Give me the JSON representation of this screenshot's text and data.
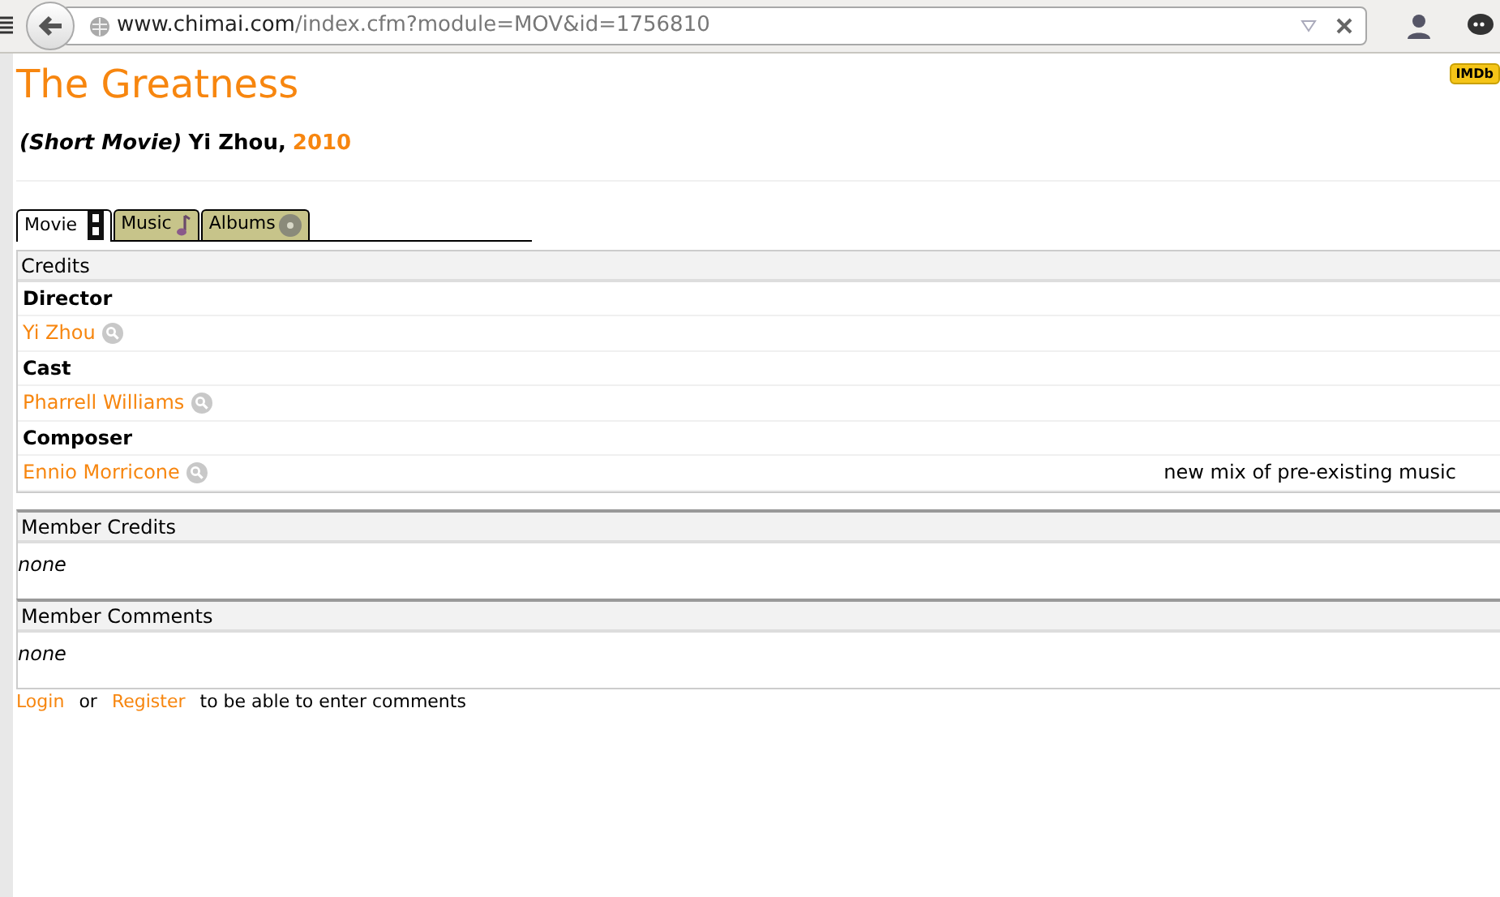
{
  "browser": {
    "url_host": "www.chimai.com",
    "url_path": "/index.cfm?module=MOV&id=1756810"
  },
  "movie": {
    "title": "The Greatness",
    "type": "(Short Movie)",
    "director": "Yi Zhou,",
    "year": "2010",
    "imdb": "IMDb"
  },
  "tabs": [
    {
      "label": "Movie",
      "kind": "film",
      "selected": true
    },
    {
      "label": "Music",
      "kind": "note",
      "selected": false
    },
    {
      "label": "Albums",
      "kind": "disc",
      "selected": false
    }
  ],
  "credits": {
    "header": "Credits",
    "rows": [
      {
        "kind": "role",
        "name": "Director"
      },
      {
        "kind": "person",
        "name": "Yi Zhou"
      },
      {
        "kind": "role",
        "name": "Cast"
      },
      {
        "kind": "person",
        "name": "Pharrell Williams"
      },
      {
        "kind": "role",
        "name": "Composer"
      },
      {
        "kind": "person",
        "name": "Ennio Morricone",
        "note": "new mix of pre-existing music"
      }
    ]
  },
  "sections": [
    {
      "header": "Member Credits",
      "body": "none"
    },
    {
      "header": "Member Comments",
      "body": "none"
    }
  ],
  "footer": {
    "login": "Login",
    "or": "or",
    "register": "Register",
    "text": "to be able to enter comments"
  }
}
